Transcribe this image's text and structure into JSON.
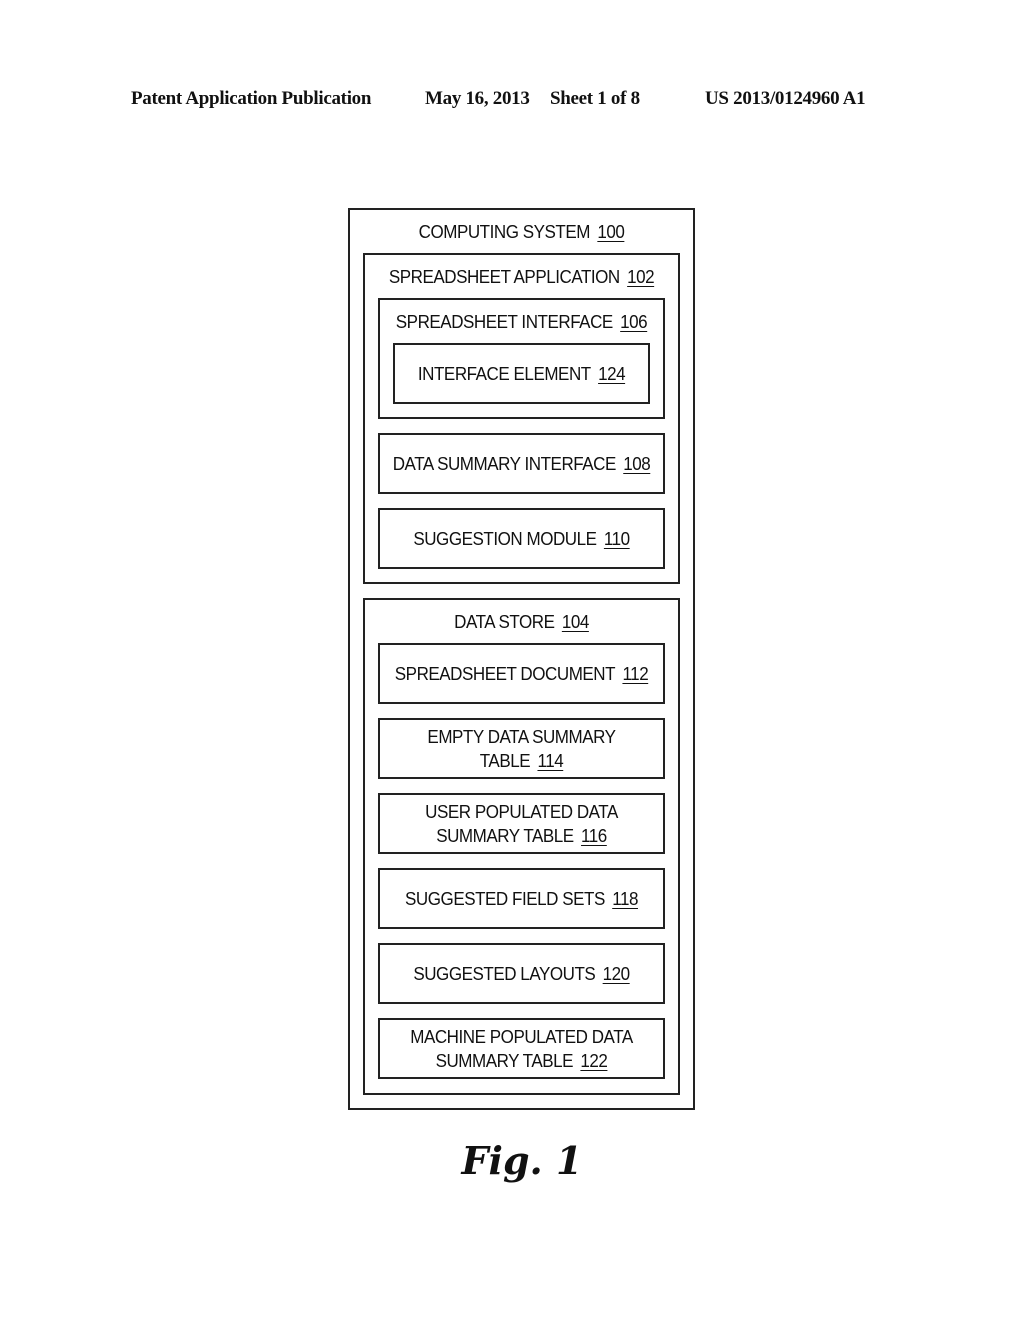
{
  "header": {
    "publication": "Patent Application Publication",
    "date": "May 16, 2013",
    "sheet": "Sheet 1 of 8",
    "number": "US 2013/0124960 A1"
  },
  "diagram": {
    "computing_system": {
      "label": "COMPUTING SYSTEM",
      "ref": "100"
    },
    "spreadsheet_application": {
      "label": "SPREADSHEET APPLICATION",
      "ref": "102"
    },
    "spreadsheet_interface": {
      "label": "SPREADSHEET INTERFACE",
      "ref": "106"
    },
    "interface_element": {
      "label": "INTERFACE ELEMENT",
      "ref": "124"
    },
    "data_summary_interface": {
      "label": "DATA SUMMARY INTERFACE",
      "ref": "108"
    },
    "suggestion_module": {
      "label": "SUGGESTION MODULE",
      "ref": "110"
    },
    "data_store": {
      "label": "DATA STORE",
      "ref": "104"
    },
    "spreadsheet_document": {
      "label": "SPREADSHEET DOCUMENT",
      "ref": "112"
    },
    "empty_data_summary_table": {
      "line1": "EMPTY DATA SUMMARY",
      "line2": "TABLE",
      "ref": "114"
    },
    "user_populated_table": {
      "line1": "USER POPULATED DATA",
      "line2": "SUMMARY TABLE",
      "ref": "116"
    },
    "suggested_field_sets": {
      "label": "SUGGESTED FIELD SETS",
      "ref": "118"
    },
    "suggested_layouts": {
      "label": "SUGGESTED LAYOUTS",
      "ref": "120"
    },
    "machine_populated_table": {
      "line1": "MACHINE POPULATED DATA",
      "line2": "SUMMARY TABLE",
      "ref": "122"
    }
  },
  "figure_label": "Fig. 1"
}
